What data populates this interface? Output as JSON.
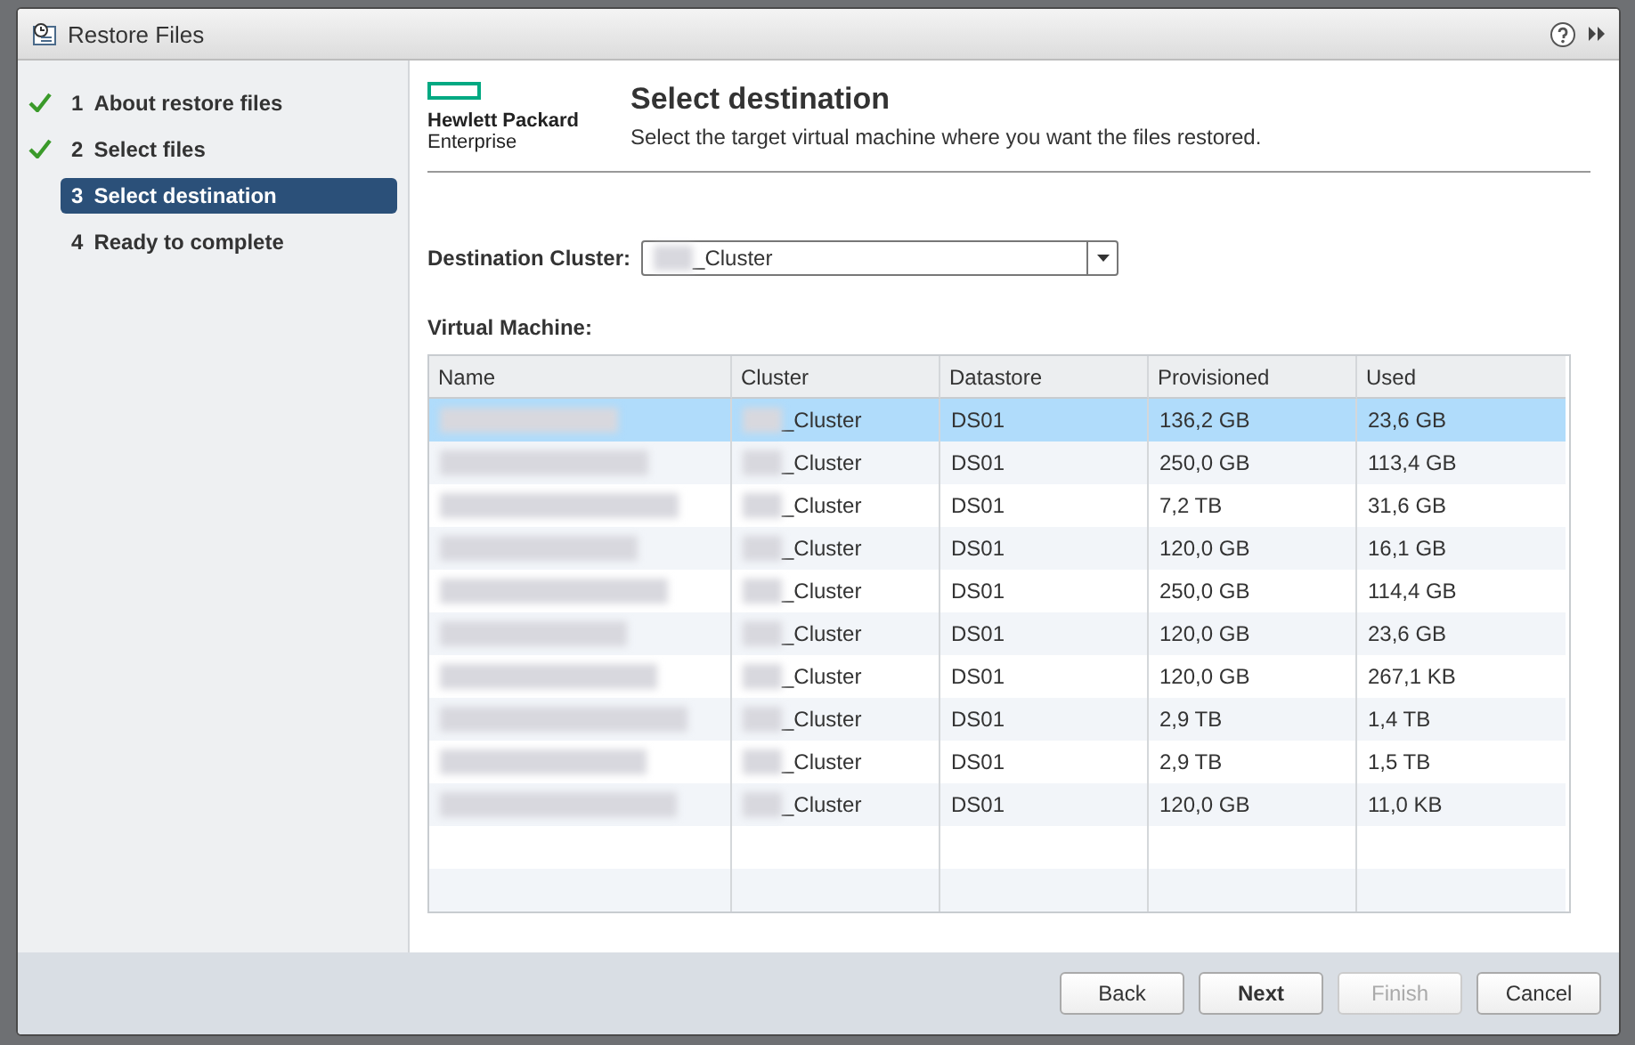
{
  "window": {
    "title": "Restore Files"
  },
  "steps": [
    {
      "number": "1",
      "label": "About restore files",
      "completed": true,
      "selected": false
    },
    {
      "number": "2",
      "label": "Select files",
      "completed": true,
      "selected": false
    },
    {
      "number": "3",
      "label": "Select destination",
      "completed": false,
      "selected": true
    },
    {
      "number": "4",
      "label": "Ready to complete",
      "completed": false,
      "selected": false
    }
  ],
  "header": {
    "logo_line_1": "Hewlett Packard",
    "logo_line_2": "Enterprise",
    "title": "Select destination",
    "subtitle": "Select the target virtual machine where you want the files restored."
  },
  "destination_cluster": {
    "label": "Destination Cluster:",
    "value": "_Cluster"
  },
  "table": {
    "label": "Virtual Machine:",
    "columns": [
      "Name",
      "Cluster",
      "Datastore",
      "Provisioned",
      "Used"
    ],
    "rows": [
      {
        "cluster": "_Cluster",
        "datastore": "DS01",
        "provisioned": "136,2 GB",
        "used": "23,6 GB",
        "selected": true
      },
      {
        "cluster": "_Cluster",
        "datastore": "DS01",
        "provisioned": "250,0 GB",
        "used": "113,4 GB",
        "selected": false
      },
      {
        "cluster": "_Cluster",
        "datastore": "DS01",
        "provisioned": "7,2 TB",
        "used": "31,6 GB",
        "selected": false
      },
      {
        "cluster": "_Cluster",
        "datastore": "DS01",
        "provisioned": "120,0 GB",
        "used": "16,1 GB",
        "selected": false
      },
      {
        "cluster": "_Cluster",
        "datastore": "DS01",
        "provisioned": "250,0 GB",
        "used": "114,4 GB",
        "selected": false
      },
      {
        "cluster": "_Cluster",
        "datastore": "DS01",
        "provisioned": "120,0 GB",
        "used": "23,6 GB",
        "selected": false
      },
      {
        "cluster": "_Cluster",
        "datastore": "DS01",
        "provisioned": "120,0 GB",
        "used": "267,1 KB",
        "selected": false
      },
      {
        "cluster": "_Cluster",
        "datastore": "DS01",
        "provisioned": "2,9 TB",
        "used": "1,4 TB",
        "selected": false
      },
      {
        "cluster": "_Cluster",
        "datastore": "DS01",
        "provisioned": "2,9 TB",
        "used": "1,5 TB",
        "selected": false
      },
      {
        "cluster": "_Cluster",
        "datastore": "DS01",
        "provisioned": "120,0 GB",
        "used": "11,0 KB",
        "selected": false
      }
    ]
  },
  "buttons": [
    {
      "label": "Back",
      "primary": false,
      "disabled": false
    },
    {
      "label": "Next",
      "primary": true,
      "disabled": false
    },
    {
      "label": "Finish",
      "primary": false,
      "disabled": true
    },
    {
      "label": "Cancel",
      "primary": false,
      "disabled": false
    }
  ]
}
